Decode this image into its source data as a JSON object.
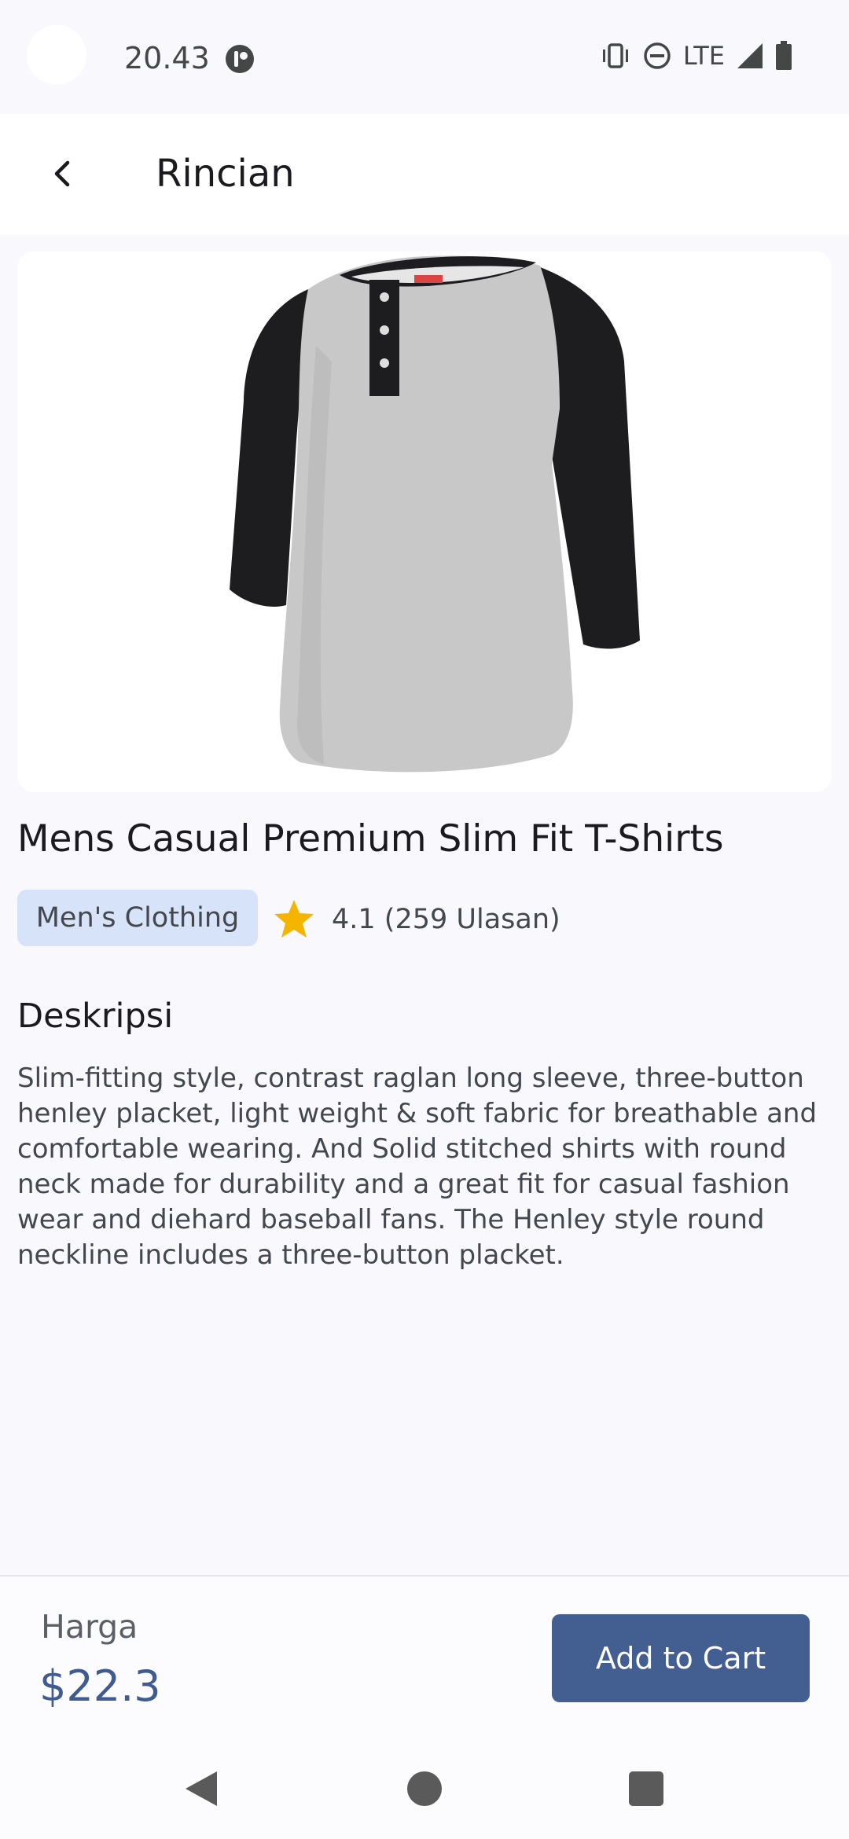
{
  "status_bar": {
    "time": "20.43",
    "network": "LTE"
  },
  "app_bar": {
    "title": "Rincian"
  },
  "product": {
    "title": "Mens Casual Premium Slim Fit T-Shirts",
    "category": "Men's Clothing",
    "rating_text": "4.1 (259 Ulasan)",
    "description_title": "Deskripsi",
    "description": "Slim-fitting style, contrast raglan long sleeve, three-button henley placket, light weight & soft fabric for breathable and comfortable wearing. And Solid stitched shirts with round neck made for durability and a great fit for casual fashion wear and diehard baseball fans. The Henley style round neckline includes a three-button placket."
  },
  "bottom_bar": {
    "price_label": "Harga",
    "price_value": "$22.3",
    "add_to_cart_label": "Add to Cart"
  },
  "colors": {
    "accent": "#435e91",
    "chip": "#d7e3f8",
    "star": "#f4b400"
  },
  "icons": {
    "back": "arrow-back-icon",
    "star": "star-icon",
    "vibrate": "vibrate-icon",
    "dnd": "do-not-disturb-icon",
    "signal": "signal-icon",
    "battery": "battery-icon"
  }
}
